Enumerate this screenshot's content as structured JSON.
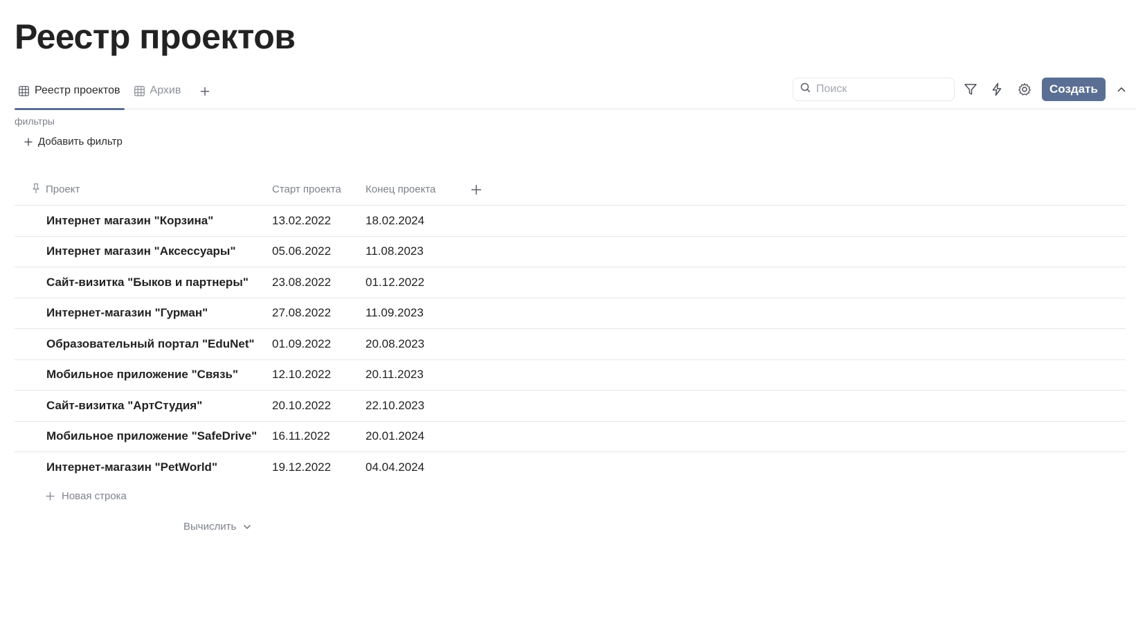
{
  "page": {
    "title": "Реестр проектов"
  },
  "tabs": [
    {
      "label": "Реестр проектов",
      "icon": "table-icon",
      "active": true
    },
    {
      "label": "Архив",
      "icon": "table-icon",
      "active": false
    }
  ],
  "toolbar": {
    "search_placeholder": "Поиск",
    "create_label": "Создать",
    "icons": [
      "search-icon",
      "filter-icon",
      "lightning-icon",
      "gear-icon",
      "chevron-up-icon"
    ],
    "accent_color": "#5a6f93"
  },
  "filters": {
    "label": "фильтры",
    "add_label": "Добавить фильтр"
  },
  "table": {
    "columns": {
      "project": "Проект",
      "start": "Старт проекта",
      "end": "Конец проекта"
    },
    "rows": [
      {
        "project": "Интернет магазин \"Корзина\"",
        "start": "13.02.2022",
        "end": "18.02.2024"
      },
      {
        "project": "Интернет магазин \"Аксессуары\"",
        "start": "05.06.2022",
        "end": "11.08.2023"
      },
      {
        "project": "Сайт-визитка \"Быков и партнеры\"",
        "start": "23.08.2022",
        "end": "01.12.2022"
      },
      {
        "project": "Интернет-магазин \"Гурман\"",
        "start": "27.08.2022",
        "end": "11.09.2023"
      },
      {
        "project": "Образовательный портал \"EduNet\"",
        "start": "01.09.2022",
        "end": "20.08.2023"
      },
      {
        "project": "Мобильное приложение \"Связь\"",
        "start": "12.10.2022",
        "end": "20.11.2023"
      },
      {
        "project": "Сайт-визитка \"АртСтудия\"",
        "start": "20.10.2022",
        "end": "22.10.2023"
      },
      {
        "project": "Мобильное приложение \"SafeDrive\"",
        "start": "16.11.2022",
        "end": "20.01.2024"
      },
      {
        "project": "Интернет-магазин \"PetWorld\"",
        "start": "19.12.2022",
        "end": "04.04.2024"
      }
    ],
    "new_row_label": "Новая строка",
    "calc_label": "Вычислить"
  }
}
